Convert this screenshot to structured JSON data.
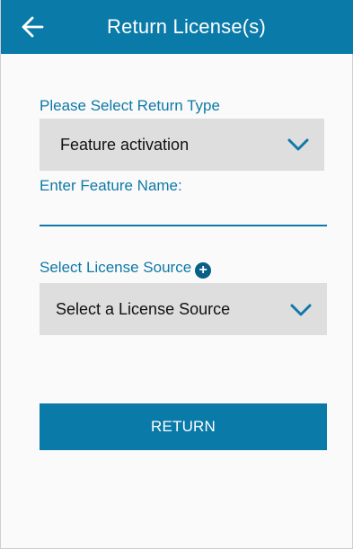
{
  "header": {
    "title": "Return License(s)",
    "back_icon": "arrow-left-icon"
  },
  "form": {
    "return_type": {
      "label": "Please Select Return Type",
      "selected": "Feature activation",
      "chevron_icon": "chevron-down-icon"
    },
    "feature_name": {
      "label": "Enter Feature Name:",
      "value": ""
    },
    "license_source": {
      "label": "Select License Source",
      "add_icon": "plus-circle-icon",
      "selected": "Select a License Source",
      "chevron_icon": "chevron-down-icon"
    }
  },
  "actions": {
    "return_label": "RETURN"
  },
  "colors": {
    "primary": "#0a7aa8",
    "label_blue": "#0f79a7",
    "select_bg": "#dedede",
    "background": "#fafafa"
  }
}
